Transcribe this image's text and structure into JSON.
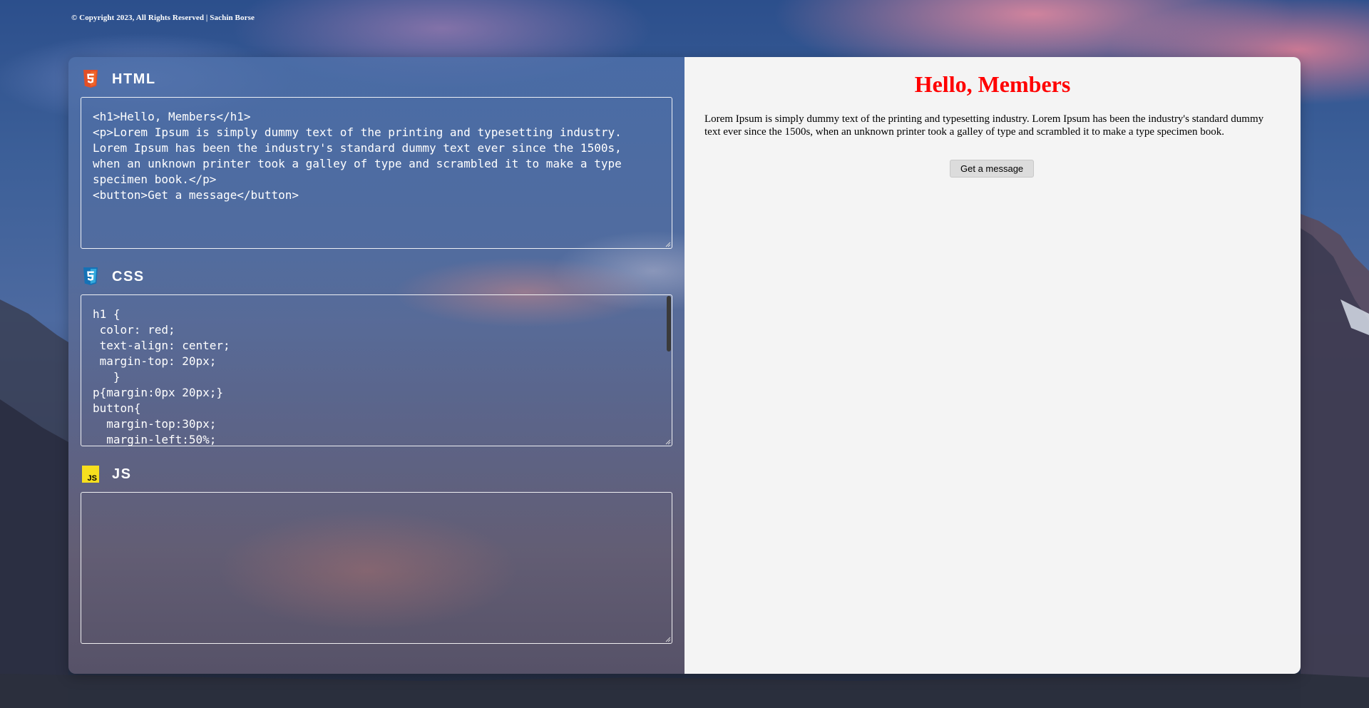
{
  "footer": {
    "copyright": "© Copyright 2023, All Rights Reserved | Sachin Borse"
  },
  "editors": {
    "html": {
      "title": "HTML",
      "icon": "html5-icon",
      "icon_color": "#e34f26",
      "code": "<h1>Hello, Members</h1>\n<p>Lorem Ipsum is simply dummy text of the printing and typesetting industry.\nLorem Ipsum has been the industry's standard dummy text ever since the 1500s,\nwhen an unknown printer took a galley of type and scrambled it to make a type\nspecimen book.</p>\n<button>Get a message</button>"
    },
    "css": {
      "title": "CSS",
      "icon": "css3-icon",
      "icon_color": "#1572b6",
      "code": "h1 {\n color: red;\n text-align: center;\n margin-top: 20px;\n   }\np{margin:0px 20px;}\nbutton{\n  margin-top:30px;\n  margin-left:50%;"
    },
    "js": {
      "title": "JS",
      "icon": "javascript-icon",
      "icon_color": "#f7df1e",
      "icon_text": "JS",
      "code": ""
    }
  },
  "preview": {
    "heading": "Hello, Members",
    "heading_color": "#ff0000",
    "paragraph": "Lorem Ipsum is simply dummy text of the printing and typesetting industry. Lorem Ipsum has been the industry's standard dummy text ever since the 1500s, when an unknown printer took a galley of type and scrambled it to make a type specimen book.",
    "button_label": "Get a message"
  }
}
